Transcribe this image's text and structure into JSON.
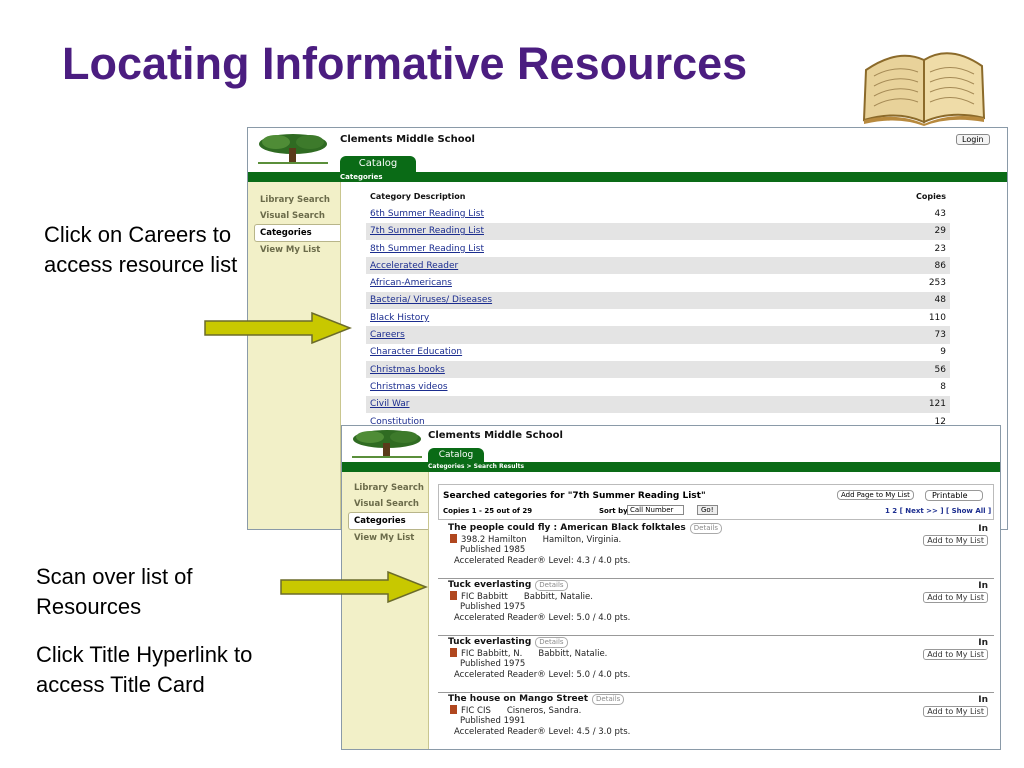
{
  "slide": {
    "title": "Locating Informative Resources",
    "caption_careers": "Click on Careers to access resource list",
    "caption_scan": "Scan over list of Resources",
    "caption_click": "Click Title Hyperlink to access Title Card"
  },
  "win1": {
    "school": "Clements Middle School",
    "login": "Login",
    "tab": "Catalog",
    "breadcrumb": "Categories",
    "sidebar": [
      "Library Search",
      "Visual Search",
      "Categories",
      "View My List"
    ],
    "table": {
      "col1": "Category Description",
      "col2": "Copies",
      "rows": [
        {
          "name": "6th Summer Reading List",
          "copies": "43"
        },
        {
          "name": "7th Summer Reading List",
          "copies": "29"
        },
        {
          "name": "8th Summer Reading List",
          "copies": "23"
        },
        {
          "name": "Accelerated Reader",
          "copies": "86"
        },
        {
          "name": "African-Americans",
          "copies": "253"
        },
        {
          "name": "Bacteria/ Viruses/ Diseases",
          "copies": "48"
        },
        {
          "name": "Black History",
          "copies": "110"
        },
        {
          "name": "Careers",
          "copies": "73"
        },
        {
          "name": "Character Education",
          "copies": "9"
        },
        {
          "name": "Christmas books",
          "copies": "56"
        },
        {
          "name": "Christmas videos",
          "copies": "8"
        },
        {
          "name": "Civil War",
          "copies": "121"
        },
        {
          "name": "Constitution",
          "copies": "12"
        }
      ]
    }
  },
  "win2": {
    "school": "Clements Middle School",
    "tab": "Catalog",
    "breadcrumb": "Categories > Search Results",
    "sidebar": [
      "Library Search",
      "Visual Search",
      "Categories",
      "View My List"
    ],
    "heading": "Searched categories for \"7th Summer Reading List\"",
    "add_page": "Add Page to My List",
    "printable": "Printable",
    "copies_range": "Copies 1 - 25 out of 29",
    "sort_by": "Sort by",
    "sort_value": "Call Number",
    "go": "Go!",
    "pages": "1 2 [ Next >> ] [ Show All ]",
    "details": "Details",
    "add_to_list": "Add to My List",
    "results": [
      {
        "title": "The people could fly : American Black folktales",
        "call": "398.2 Hamilton",
        "author": "Hamilton, Virginia.",
        "published": "Published 1985",
        "ar": "Accelerated Reader® Level:  4.3 / 4.0 pts.",
        "status": "In"
      },
      {
        "title": "Tuck everlasting",
        "call": "FIC Babbitt",
        "author": "Babbitt, Natalie.",
        "published": "Published 1975",
        "ar": "Accelerated Reader® Level:  5.0 / 4.0 pts.",
        "status": "In"
      },
      {
        "title": "Tuck everlasting",
        "call": "FIC Babbitt, N.",
        "author": "Babbitt, Natalie.",
        "published": "Published 1975",
        "ar": "Accelerated Reader® Level:  5.0 / 4.0 pts.",
        "status": "In"
      },
      {
        "title": "The house on Mango Street",
        "call": "FIC CIS",
        "author": "Cisneros, Sandra.",
        "published": "Published 1991",
        "ar": "Accelerated Reader® Level:  4.5 / 3.0 pts.",
        "status": "In"
      }
    ]
  },
  "colors": {
    "title": "#4b1d80",
    "green": "#0a6b16",
    "sidebar": "#f2f0c8",
    "arrow": "#c8c800"
  },
  "icons": {
    "book_image": "open-book-icon",
    "logo": "tree-logo-icon",
    "arrow": "right-arrow-icon"
  }
}
